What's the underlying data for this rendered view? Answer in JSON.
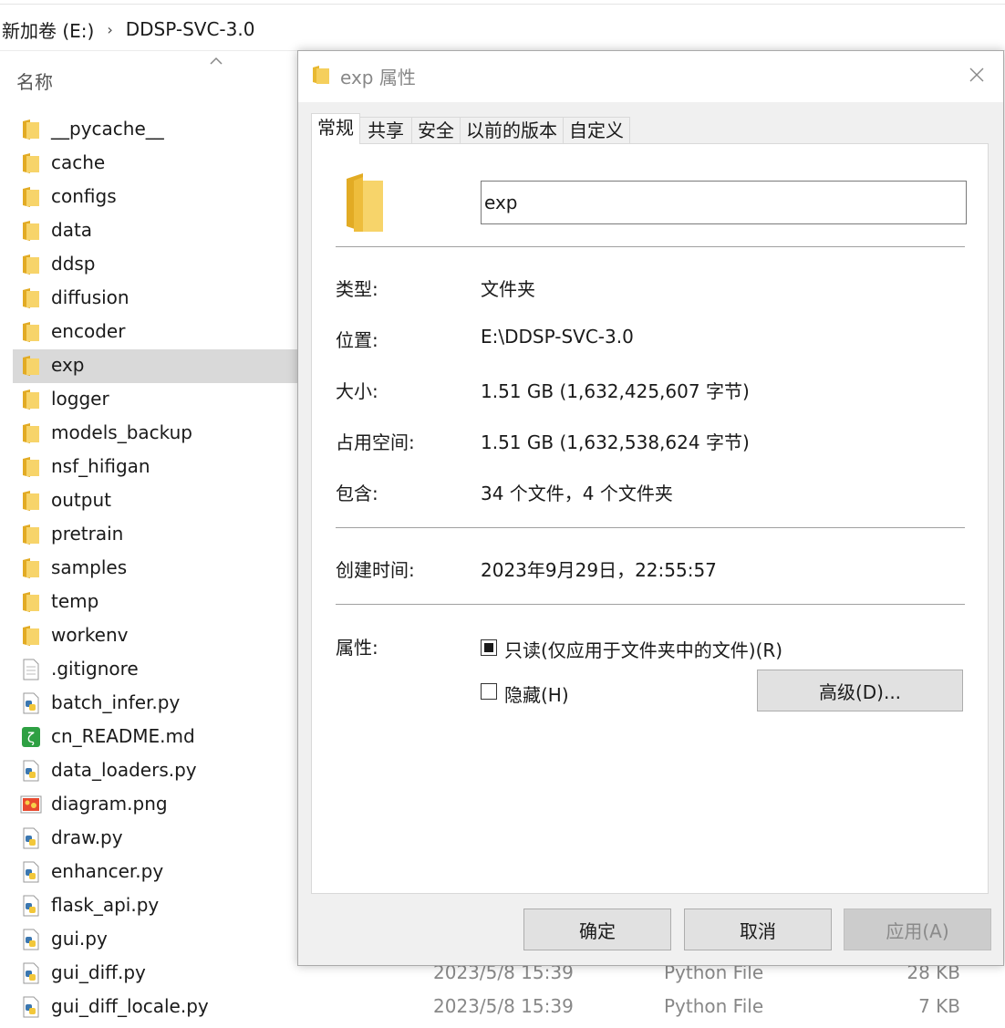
{
  "breadcrumb": {
    "drive": "新加卷 (E:)",
    "separator": "›",
    "folder": "DDSP-SVC-3.0"
  },
  "column_header": {
    "name": "名称"
  },
  "files": [
    {
      "name": "__pycache__",
      "icon": "folder-icon"
    },
    {
      "name": "cache",
      "icon": "folder-icon"
    },
    {
      "name": "configs",
      "icon": "folder-icon"
    },
    {
      "name": "data",
      "icon": "folder-icon"
    },
    {
      "name": "ddsp",
      "icon": "folder-icon"
    },
    {
      "name": "diffusion",
      "icon": "folder-icon"
    },
    {
      "name": "encoder",
      "icon": "folder-icon"
    },
    {
      "name": "exp",
      "icon": "folder-icon",
      "selected": true
    },
    {
      "name": "logger",
      "icon": "folder-icon"
    },
    {
      "name": "models_backup",
      "icon": "folder-icon"
    },
    {
      "name": "nsf_hifigan",
      "icon": "folder-icon"
    },
    {
      "name": "output",
      "icon": "folder-icon"
    },
    {
      "name": "pretrain",
      "icon": "folder-icon"
    },
    {
      "name": "samples",
      "icon": "folder-icon"
    },
    {
      "name": "temp",
      "icon": "folder-icon"
    },
    {
      "name": "workenv",
      "icon": "folder-icon"
    },
    {
      "name": ".gitignore",
      "icon": "text-file-icon"
    },
    {
      "name": "batch_infer.py",
      "icon": "python-file-icon"
    },
    {
      "name": "cn_README.md",
      "icon": "markdown-file-icon"
    },
    {
      "name": "data_loaders.py",
      "icon": "python-file-icon"
    },
    {
      "name": "diagram.png",
      "icon": "image-file-icon"
    },
    {
      "name": "draw.py",
      "icon": "python-file-icon"
    },
    {
      "name": "enhancer.py",
      "icon": "python-file-icon"
    },
    {
      "name": "flask_api.py",
      "icon": "python-file-icon"
    },
    {
      "name": "gui.py",
      "icon": "python-file-icon"
    },
    {
      "name": "gui_diff.py",
      "icon": "python-file-icon",
      "date": "2023/5/8 15:39",
      "type": "Python File",
      "size": "28 KB"
    },
    {
      "name": "gui_diff_locale.py",
      "icon": "python-file-icon",
      "date": "2023/5/8 15:39",
      "type": "Python File",
      "size": "7 KB"
    }
  ],
  "dialog": {
    "title": "exp 属性",
    "tabs": [
      "常规",
      "共享",
      "安全",
      "以前的版本",
      "自定义"
    ],
    "active_tab": 0,
    "folder_name": "exp",
    "properties": {
      "type_label": "类型:",
      "type_value": "文件夹",
      "location_label": "位置:",
      "location_value": "E:\\DDSP-SVC-3.0",
      "size_label": "大小:",
      "size_value": "1.51 GB (1,632,425,607 字节)",
      "disk_label": "占用空间:",
      "disk_value": "1.51 GB (1,632,538,624 字节)",
      "contains_label": "包含:",
      "contains_value": "34 个文件，4 个文件夹",
      "created_label": "创建时间:",
      "created_value": "2023年9月29日，22:55:57",
      "attributes_label": "属性:"
    },
    "readonly_label": "只读(仅应用于文件夹中的文件)(R)",
    "readonly_state": "indeterminate",
    "hidden_label": "隐藏(H)",
    "hidden_checked": false,
    "advanced_button": "高级(D)...",
    "ok_button": "确定",
    "cancel_button": "取消",
    "apply_button": "应用(A)"
  },
  "colors": {
    "folder": "#f5c842",
    "selected_row": "#d9d9d9",
    "dialog_bg": "#f0f0f0",
    "button_bg": "#e1e1e1"
  }
}
